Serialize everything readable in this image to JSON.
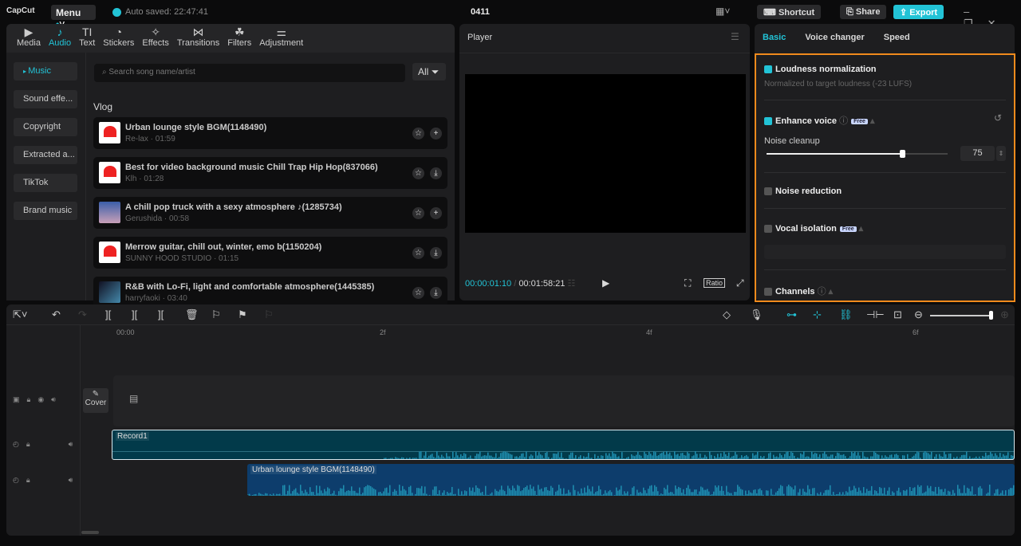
{
  "app": {
    "logo": "CapCut",
    "menu": "Menu",
    "auto_saved": "Auto saved: 22:47:41",
    "project": "0411",
    "shortcut": "Shortcut",
    "share": "Share",
    "export": "Export"
  },
  "tabs": [
    {
      "label": "Media",
      "icon": "▶"
    },
    {
      "label": "Audio",
      "icon": "♪"
    },
    {
      "label": "Text",
      "icon": "TI"
    },
    {
      "label": "Stickers",
      "icon": "◔"
    },
    {
      "label": "Effects",
      "icon": "✧"
    },
    {
      "label": "Transitions",
      "icon": "⋈"
    },
    {
      "label": "Filters",
      "icon": "☘"
    },
    {
      "label": "Adjustment",
      "icon": "⚌"
    }
  ],
  "sidebar": [
    "Music",
    "Sound effe...",
    "Copyright",
    "Extracted a...",
    "TikTok",
    "Brand music"
  ],
  "search": {
    "placeholder": "Search song name/artist",
    "filter": "All"
  },
  "section": "Vlog",
  "songs": [
    {
      "title": "Urban lounge style BGM(1148490)",
      "sub": "Re-lax · 01:59",
      "action": "+"
    },
    {
      "title": "Best for video background music Chill Trap Hip Hop(837066)",
      "sub": "Klh · 01:28",
      "action": "⤓"
    },
    {
      "title": "A chill pop truck with a sexy atmosphere ♪(1285734)",
      "sub": "Gerushida · 00:58",
      "action": "+"
    },
    {
      "title": "Merrow guitar, chill out, winter, emo b(1150204)",
      "sub": "SUNNY HOOD STUDIO · 01:15",
      "action": "⤓"
    },
    {
      "title": "R&B with Lo-Fi, light and comfortable atmosphere(1445385)",
      "sub": "harryfaoki · 03:40",
      "action": "⤓"
    }
  ],
  "player": {
    "title": "Player",
    "current": "00:00:01:10",
    "total": "00:01:58:21",
    "ratio": "Ratio"
  },
  "right": {
    "tabs": [
      "Basic",
      "Voice changer",
      "Speed"
    ],
    "loudness": {
      "label": "Loudness normalization",
      "desc": "Normalized to target loudness (-23 LUFS)",
      "checked": true
    },
    "enhance": {
      "label": "Enhance voice",
      "badge": "Free",
      "checked": true
    },
    "noise_cleanup": {
      "label": "Noise cleanup",
      "value": "75",
      "fraction": 0.75
    },
    "noise_reduction": {
      "label": "Noise reduction",
      "checked": false
    },
    "vocal": {
      "label": "Vocal isolation",
      "badge": "Free",
      "checked": false
    },
    "channels": {
      "label": "Channels",
      "checked": false
    }
  },
  "timeline": {
    "ruler": [
      "00:00",
      "2f",
      "4f",
      "6f"
    ],
    "cover": "Cover",
    "clip1": "Record1",
    "clip2": "Urban lounge style BGM(1148490)"
  },
  "colors": {
    "accent": "#22c3d6",
    "highlight": "#f08a1c"
  }
}
